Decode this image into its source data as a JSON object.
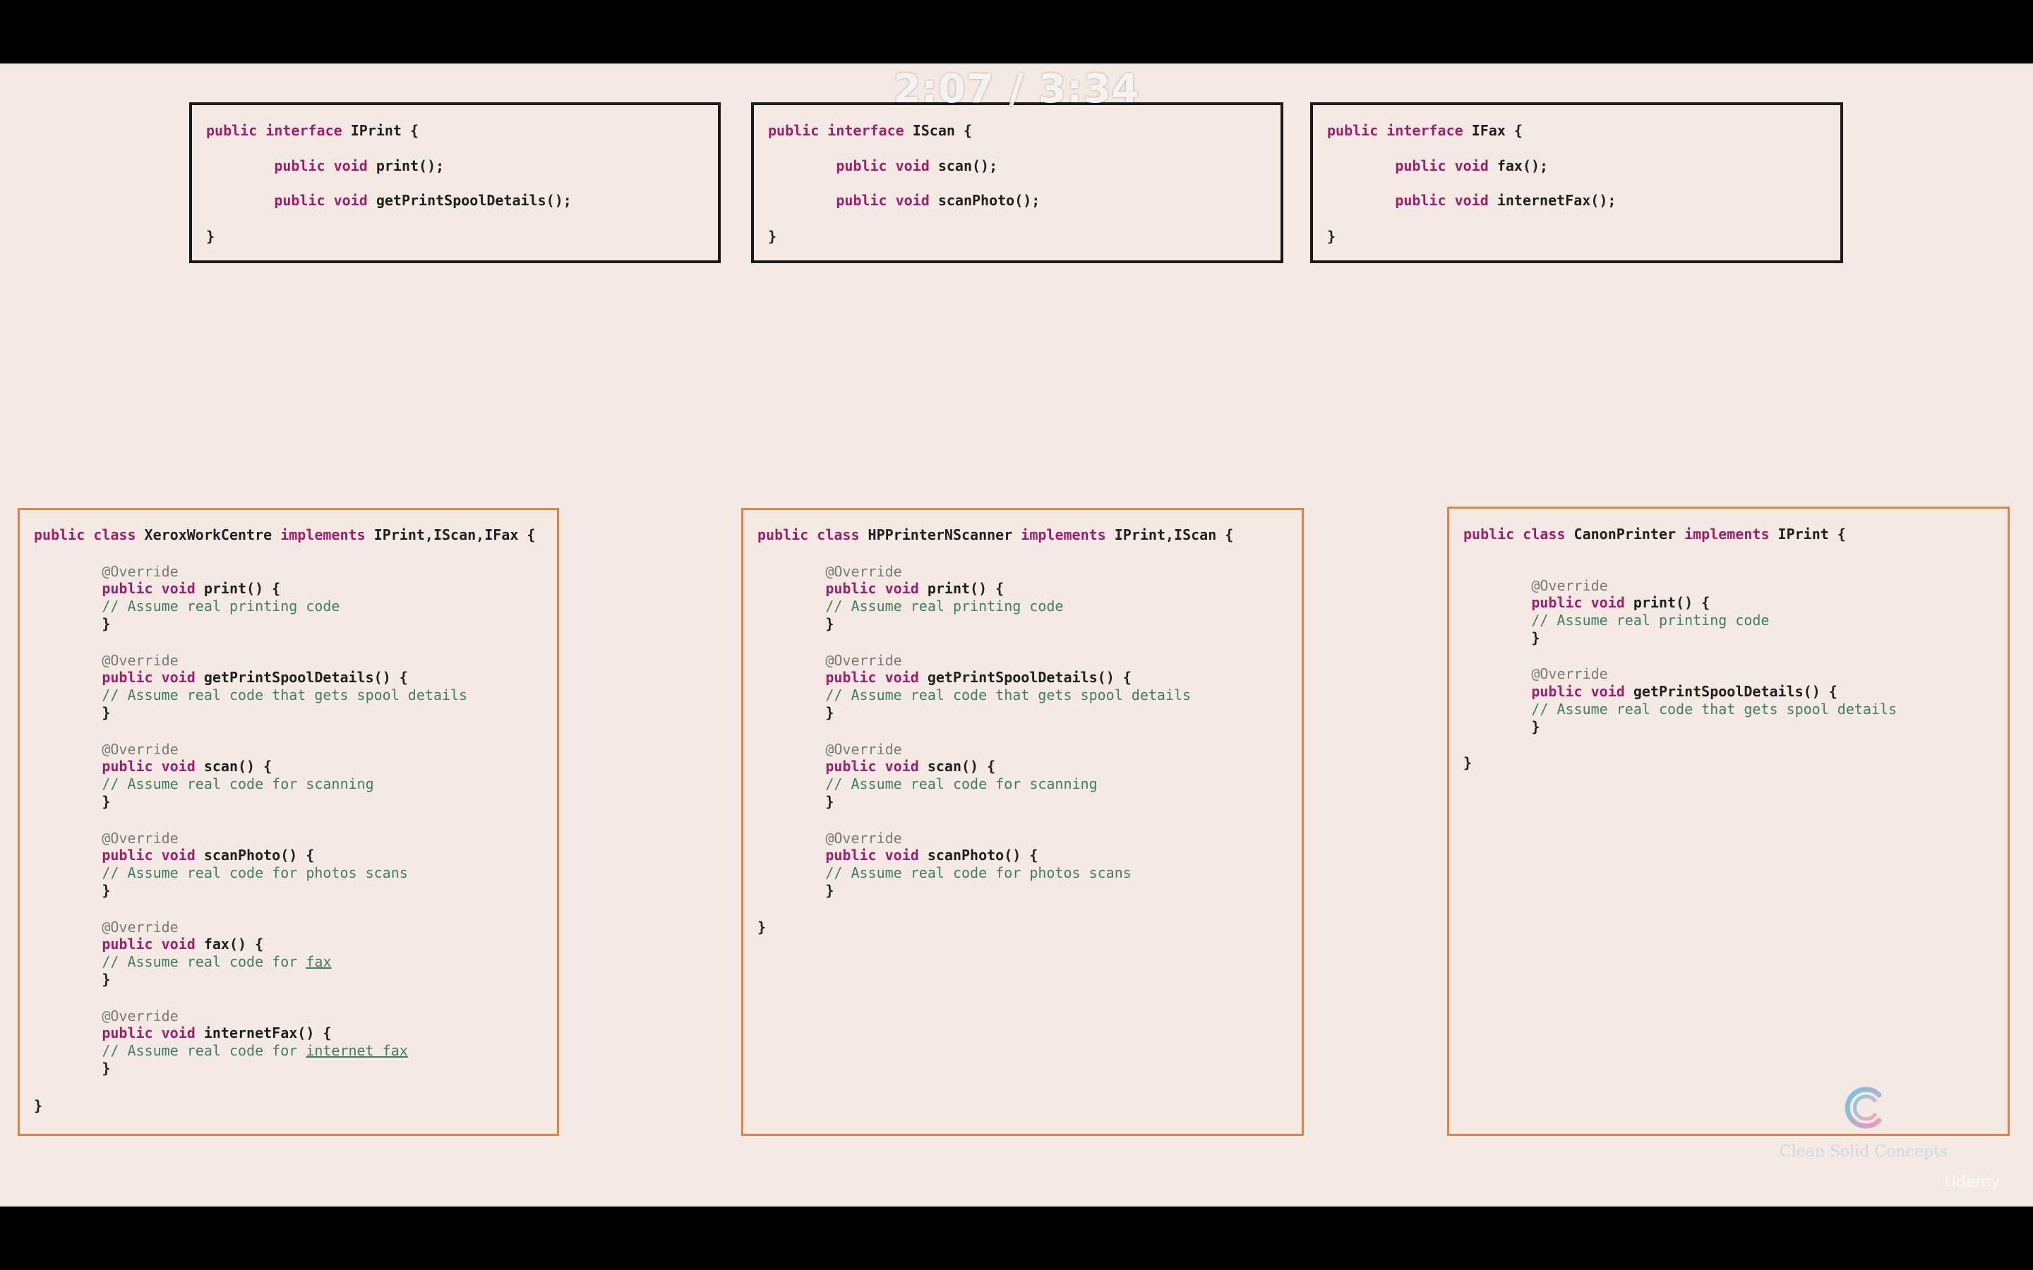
{
  "player": {
    "timer": "2:07 / 3:34",
    "watermark": "Udemy"
  },
  "brand": {
    "text": "Clean Solid Concepts"
  },
  "interfaces": [
    {
      "name": "IPrint",
      "lines": [
        [
          {
            "t": "public interface ",
            "c": "kw"
          },
          {
            "t": "IPrint {",
            "c": "id"
          }
        ],
        [
          {
            "t": "        public void ",
            "c": "kw"
          },
          {
            "t": "print();",
            "c": "id"
          }
        ],
        [
          {
            "t": "        public void ",
            "c": "kw"
          },
          {
            "t": "getPrintSpoolDetails();",
            "c": "id"
          }
        ],
        [
          {
            "t": "}",
            "c": "id"
          }
        ]
      ]
    },
    {
      "name": "IScan",
      "lines": [
        [
          {
            "t": "public interface ",
            "c": "kw"
          },
          {
            "t": "IScan {",
            "c": "id"
          }
        ],
        [
          {
            "t": "        public void ",
            "c": "kw"
          },
          {
            "t": "scan();",
            "c": "id"
          }
        ],
        [
          {
            "t": "        public void ",
            "c": "kw"
          },
          {
            "t": "scanPhoto();",
            "c": "id"
          }
        ],
        [
          {
            "t": "}",
            "c": "id"
          }
        ]
      ]
    },
    {
      "name": "IFax",
      "lines": [
        [
          {
            "t": "public interface ",
            "c": "kw"
          },
          {
            "t": "IFax {",
            "c": "id"
          }
        ],
        [
          {
            "t": "        public void ",
            "c": "kw"
          },
          {
            "t": "fax();",
            "c": "id"
          }
        ],
        [
          {
            "t": "        public void ",
            "c": "kw"
          },
          {
            "t": "internetFax();",
            "c": "id"
          }
        ],
        [
          {
            "t": "}",
            "c": "id"
          }
        ]
      ]
    }
  ],
  "classes": [
    {
      "name": "XeroxWorkCentre",
      "lines": [
        [
          {
            "t": "public class ",
            "c": "kw"
          },
          {
            "t": "XeroxWorkCentre ",
            "c": "id"
          },
          {
            "t": "implements ",
            "c": "kw"
          },
          {
            "t": "IPrint,IScan,IFax {",
            "c": "id"
          }
        ],
        [
          {
            "t": "        @Override",
            "c": "ann"
          }
        ],
        [
          {
            "t": "        public void ",
            "c": "kw"
          },
          {
            "t": "print() {",
            "c": "id"
          }
        ],
        [
          {
            "t": "        // Assume real printing code",
            "c": "cm"
          }
        ],
        [
          {
            "t": "        }",
            "c": "id"
          }
        ],
        [
          {
            "t": "        @Override",
            "c": "ann"
          }
        ],
        [
          {
            "t": "        public void ",
            "c": "kw"
          },
          {
            "t": "getPrintSpoolDetails() {",
            "c": "id"
          }
        ],
        [
          {
            "t": "        // Assume real code that gets spool details",
            "c": "cm"
          }
        ],
        [
          {
            "t": "        }",
            "c": "id"
          }
        ],
        [
          {
            "t": "        @Override",
            "c": "ann"
          }
        ],
        [
          {
            "t": "        public void ",
            "c": "kw"
          },
          {
            "t": "scan() {",
            "c": "id"
          }
        ],
        [
          {
            "t": "        // Assume real code for scanning",
            "c": "cm"
          }
        ],
        [
          {
            "t": "        }",
            "c": "id"
          }
        ],
        [
          {
            "t": "        @Override",
            "c": "ann"
          }
        ],
        [
          {
            "t": "        public void ",
            "c": "kw"
          },
          {
            "t": "scanPhoto() {",
            "c": "id"
          }
        ],
        [
          {
            "t": "        // Assume real code for photos scans",
            "c": "cm"
          }
        ],
        [
          {
            "t": "        }",
            "c": "id"
          }
        ],
        [
          {
            "t": "        @Override",
            "c": "ann"
          }
        ],
        [
          {
            "t": "        public void ",
            "c": "kw"
          },
          {
            "t": "fax() {",
            "c": "id"
          }
        ],
        [
          {
            "t": "        // Assume real code for ",
            "c": "cm"
          },
          {
            "t": "fax",
            "c": "cm ul"
          }
        ],
        [
          {
            "t": "        }",
            "c": "id"
          }
        ],
        [
          {
            "t": "        @Override",
            "c": "ann"
          }
        ],
        [
          {
            "t": "        public void ",
            "c": "kw"
          },
          {
            "t": "internetFax() {",
            "c": "id"
          }
        ],
        [
          {
            "t": "        // Assume real code for ",
            "c": "cm"
          },
          {
            "t": "internet fax",
            "c": "cm ul"
          }
        ],
        [
          {
            "t": "        }",
            "c": "id"
          }
        ],
        [
          {
            "t": "}",
            "c": "id"
          }
        ]
      ]
    },
    {
      "name": "HPPrinterNScanner",
      "lines": [
        [
          {
            "t": "public class ",
            "c": "kw"
          },
          {
            "t": "HPPrinterNScanner ",
            "c": "id"
          },
          {
            "t": "implements ",
            "c": "kw"
          },
          {
            "t": "IPrint,IScan {",
            "c": "id"
          }
        ],
        [
          {
            "t": "        @Override",
            "c": "ann"
          }
        ],
        [
          {
            "t": "        public void ",
            "c": "kw"
          },
          {
            "t": "print() {",
            "c": "id"
          }
        ],
        [
          {
            "t": "        // Assume real printing code",
            "c": "cm"
          }
        ],
        [
          {
            "t": "        }",
            "c": "id"
          }
        ],
        [
          {
            "t": "        @Override",
            "c": "ann"
          }
        ],
        [
          {
            "t": "        public void ",
            "c": "kw"
          },
          {
            "t": "getPrintSpoolDetails() {",
            "c": "id"
          }
        ],
        [
          {
            "t": "        // Assume real code that gets spool details",
            "c": "cm"
          }
        ],
        [
          {
            "t": "        }",
            "c": "id"
          }
        ],
        [
          {
            "t": "        @Override",
            "c": "ann"
          }
        ],
        [
          {
            "t": "        public void ",
            "c": "kw"
          },
          {
            "t": "scan() {",
            "c": "id"
          }
        ],
        [
          {
            "t": "        // Assume real code for scanning",
            "c": "cm"
          }
        ],
        [
          {
            "t": "        }",
            "c": "id"
          }
        ],
        [
          {
            "t": "        @Override",
            "c": "ann"
          }
        ],
        [
          {
            "t": "        public void ",
            "c": "kw"
          },
          {
            "t": "scanPhoto() {",
            "c": "id"
          }
        ],
        [
          {
            "t": "        // Assume real code for photos scans",
            "c": "cm"
          }
        ],
        [
          {
            "t": "        }",
            "c": "id"
          }
        ],
        [
          {
            "t": "}",
            "c": "id"
          }
        ]
      ]
    },
    {
      "name": "CanonPrinter",
      "lines": [
        [
          {
            "t": "public class ",
            "c": "kw"
          },
          {
            "t": "CanonPrinter ",
            "c": "id"
          },
          {
            "t": "implements ",
            "c": "kw"
          },
          {
            "t": "IPrint {",
            "c": "id"
          }
        ],
        [
          {
            "t": "        @Override",
            "c": "ann"
          }
        ],
        [
          {
            "t": "        public void ",
            "c": "kw"
          },
          {
            "t": "print() {",
            "c": "id"
          }
        ],
        [
          {
            "t": "        // Assume real printing code",
            "c": "cm"
          }
        ],
        [
          {
            "t": "        }",
            "c": "id"
          }
        ],
        [
          {
            "t": "        @Override",
            "c": "ann"
          }
        ],
        [
          {
            "t": "        public void ",
            "c": "kw"
          },
          {
            "t": "getPrintSpoolDetails() {",
            "c": "id"
          }
        ],
        [
          {
            "t": "        // Assume real code that gets spool details",
            "c": "cm"
          }
        ],
        [
          {
            "t": "        }",
            "c": "id"
          }
        ],
        [
          {
            "t": "}",
            "c": "id"
          }
        ]
      ]
    }
  ]
}
